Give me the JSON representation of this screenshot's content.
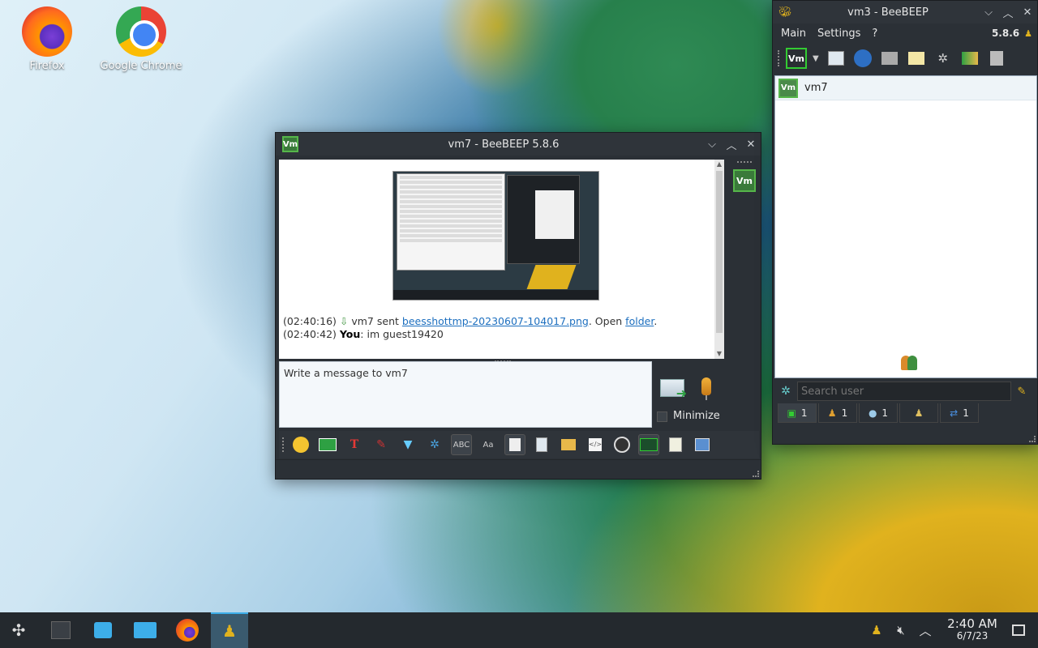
{
  "desktop": {
    "icons": [
      {
        "label": "Firefox",
        "icon": "firefox-icon"
      },
      {
        "label": "Google Chrome",
        "icon": "chrome-icon"
      }
    ]
  },
  "chat_window": {
    "title": "vm7 - BeeBEEP 5.8.6",
    "badge": "Vm",
    "side_badge": "Vm",
    "messages": [
      {
        "time": "(02:40:16)",
        "sender": "vm7",
        "verb": "sent",
        "file": "beesshottmp-20230607-104017.png",
        "mid": ". Open",
        "link": "folder",
        "end": "."
      },
      {
        "time": "(02:40:42)",
        "sender": "You",
        "text": ": im guest19420"
      }
    ],
    "input_placeholder": "Write a message to vm7",
    "minimize_label": "Minimize",
    "toolbar_icons": [
      "emoticon-icon",
      "mail-icon",
      "text-color-icon",
      "font-icon",
      "filter-icon",
      "settings-icon",
      "spellcheck-icon",
      "font-style-icon",
      "compact-view-icon",
      "send-file-icon",
      "send-folder-icon",
      "html-code-icon",
      "screenshot-icon",
      "terminal-icon",
      "save-chat-icon",
      "window-icon"
    ]
  },
  "main_window": {
    "title": "vm3 - BeeBEEP",
    "menu": [
      "Main",
      "Settings",
      "?"
    ],
    "version": "5.8.6",
    "status_badge": "Vm",
    "users": [
      {
        "avatar": "Vm",
        "name": "vm7"
      }
    ],
    "search_placeholder": "Search user",
    "tabs": [
      {
        "icon": "users-online-icon",
        "count": "1"
      },
      {
        "icon": "groups-icon",
        "count": "1"
      },
      {
        "icon": "chats-icon",
        "count": "1"
      },
      {
        "icon": "group-add-icon",
        "count": ""
      },
      {
        "icon": "files-icon",
        "count": "1"
      }
    ]
  },
  "taskbar": {
    "clock_time": "2:40 AM",
    "clock_date": "6/7/23"
  },
  "colors": {
    "accent": "#3daee9",
    "window_bg": "#2b3036",
    "link": "#1d6fbf",
    "vm_green": "#56b64a"
  }
}
